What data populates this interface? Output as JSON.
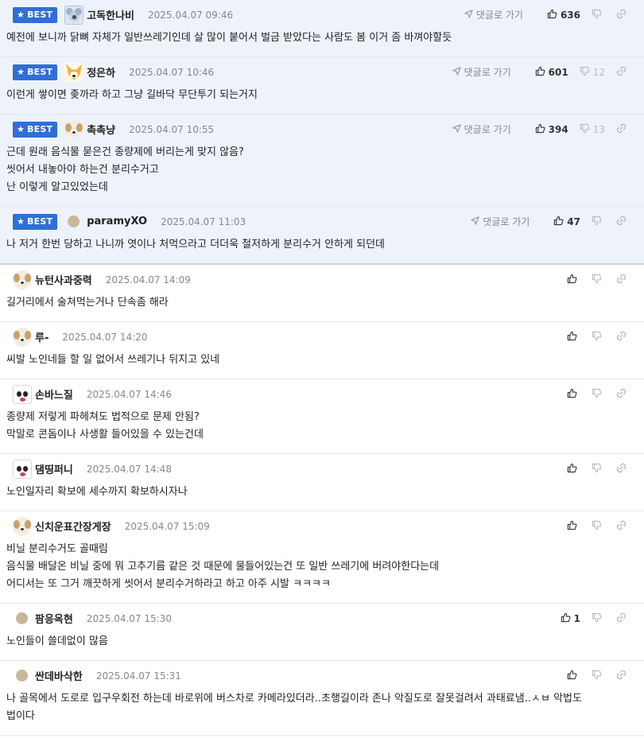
{
  "comments": [
    {
      "best": true,
      "avatar": "koala",
      "name": "고독한나비",
      "date": "2025.04.07 09:46",
      "goto": "댓글로 가기",
      "likes": "636",
      "dislikes": "",
      "text": "예전에 보니까 닭뼈 자체가 일반쓰레기인데 살 많이 붙어서 벌금 받았다는 사람도 봄 이거 좀 바껴야할듯"
    },
    {
      "best": true,
      "avatar": "fox",
      "name": "정은하",
      "date": "2025.04.07 10:46",
      "goto": "댓글로 가기",
      "likes": "601",
      "dislikes": "12",
      "text": "이런게 쌓이면 좆까라 하고 그냥 길바닥 무단투기 되는거지"
    },
    {
      "best": true,
      "avatar": "dog",
      "name": "촉촉냥",
      "date": "2025.04.07 10:55",
      "goto": "댓글로 가기",
      "likes": "394",
      "dislikes": "13",
      "text": "근데 원래 음식물 묻은건 종량제에 버리는게 맞지 않음?\n씻어서 내놓아야 하는건 분리수거고\n난 이렇게 알고있었는데"
    },
    {
      "best": true,
      "avatar": "dot",
      "name": "paramyXO",
      "date": "2025.04.07 11:03",
      "goto": "댓글로 가기",
      "likes": "47",
      "dislikes": "",
      "text": "나 저거 한번 당하고 나니까 엿이나 처먹으라고 더더욱 철저하게 분리수거 안하게 되던데"
    },
    {
      "best": false,
      "avatar": "dog",
      "name": "뉴턴사과중력",
      "date": "2025.04.07 14:09",
      "goto": "",
      "likes": "",
      "dislikes": "",
      "text": "길거리에서 술쳐먹는거나 단속좀 해라"
    },
    {
      "best": false,
      "avatar": "dog",
      "name": "루-",
      "date": "2025.04.07 14:20",
      "goto": "",
      "likes": "",
      "dislikes": "",
      "text": "씨발 노인네들 할 일 없어서 쓰레기나 뒤지고 있네"
    },
    {
      "best": false,
      "avatar": "panda",
      "name": "손바느질",
      "date": "2025.04.07 14:46",
      "goto": "",
      "likes": "",
      "dislikes": "",
      "text": "종량제 저렇게 파헤쳐도 법적으로 문제 안됨?\n막말로 콘돔이나 사생활 들어있을 수 있는건데"
    },
    {
      "best": false,
      "avatar": "panda",
      "name": "댐띵퍼니",
      "date": "2025.04.07 14:48",
      "goto": "",
      "likes": "",
      "dislikes": "",
      "text": "노인일자리 확보에 세수까지 확보하시자나"
    },
    {
      "best": false,
      "avatar": "dog",
      "name": "신치운표간장게장",
      "date": "2025.04.07 15:09",
      "goto": "",
      "likes": "",
      "dislikes": "",
      "text": "비닐 분리수거도 골때림\n음식물 배달온 비닐 중에 뭐 고추기름 같은 것 때문에 물들어있는건 또 일반 쓰레기에 버려야한다는데\n어디서는 또 그거 깨끗하게 씻어서 분리수거하라고 하고 아주 시발 ㅋㅋㅋㅋ"
    },
    {
      "best": false,
      "avatar": "dot",
      "name": "팜응옥현",
      "date": "2025.04.07 15:30",
      "goto": "",
      "likes": "1",
      "dislikes": "",
      "text": "노인들이 쓸데없이 많음"
    },
    {
      "best": false,
      "avatar": "dot",
      "name": "싼데바삭한",
      "date": "2025.04.07 15:31",
      "goto": "",
      "likes": "",
      "dislikes": "",
      "text": "나 골목에서 도로로 입구우회전 하는데 바로위에 버스차로 카메라있더라..초행길이라 존나 악질도로 잘못걸려서 과태료냄..ㅅㅂ 악법도\n법이다"
    }
  ],
  "labels": {
    "best_badge": "BEST"
  },
  "colors": {
    "best_bg": "#eef2fb",
    "badge": "#2f6fd6"
  },
  "icons": [
    "star-icon",
    "arrow-icon",
    "thumbs-up-icon",
    "thumbs-down-icon",
    "link-icon"
  ]
}
